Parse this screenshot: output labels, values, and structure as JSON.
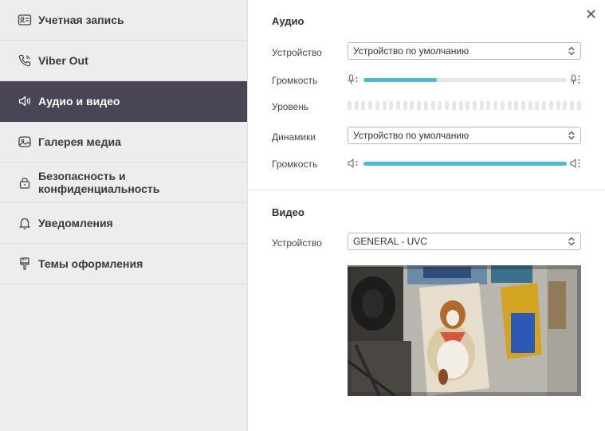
{
  "sidebar": {
    "items": [
      {
        "label": "Учетная запись",
        "icon": "account-card-icon"
      },
      {
        "label": "Viber Out",
        "icon": "phone-icon"
      },
      {
        "label": "Аудио и видео",
        "icon": "speaker-icon",
        "active": true
      },
      {
        "label": "Галерея медиа",
        "icon": "media-gallery-icon"
      },
      {
        "label": "Безопасность и конфиденциальность",
        "icon": "lock-icon"
      },
      {
        "label": "Уведомления",
        "icon": "bell-icon"
      },
      {
        "label": "Темы оформления",
        "icon": "brush-icon"
      }
    ]
  },
  "audio": {
    "title": "Аудио",
    "device_label": "Устройство",
    "device_value": "Устройство по умолчанию",
    "mic_volume_label": "Громкость",
    "mic_volume_value": 0.36,
    "level_label": "Уровень",
    "speakers_label": "Динамики",
    "speakers_value": "Устройство по умолчанию",
    "speaker_volume_label": "Громкость",
    "speaker_volume_value": 1.0
  },
  "video": {
    "title": "Видео",
    "device_label": "Устройство",
    "device_value": "GENERAL - UVC"
  },
  "colors": {
    "sidebar_bg": "#eceded",
    "active_bg": "#4a4457",
    "accent": "#4db9cc"
  }
}
